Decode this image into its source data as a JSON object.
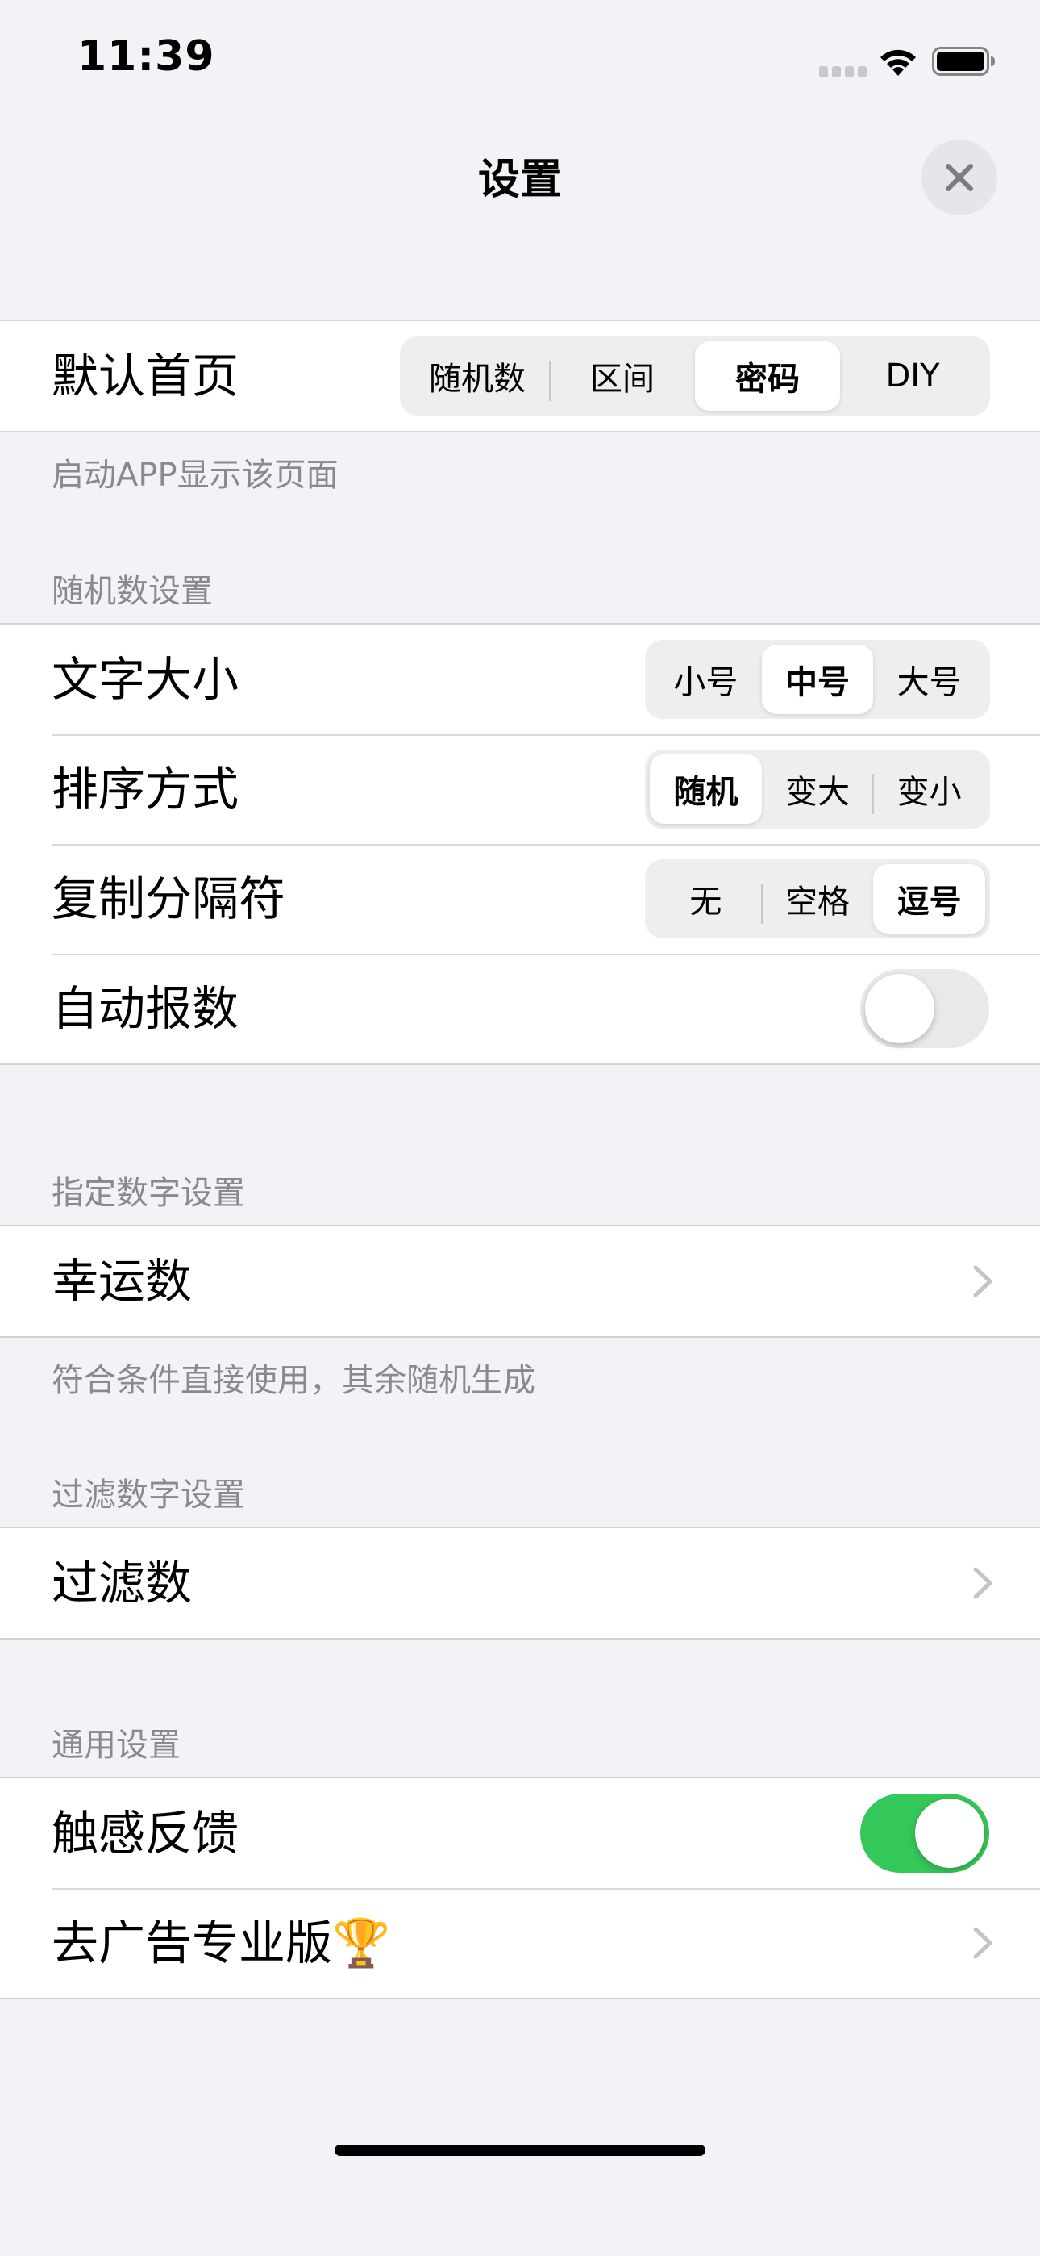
{
  "status": {
    "time": "11:39"
  },
  "nav": {
    "title": "设置"
  },
  "home_page": {
    "label": "默认首页",
    "segments": [
      "随机数",
      "区间",
      "密码",
      "DIY"
    ],
    "selected": "密码",
    "footer": "启动APP显示该页面"
  },
  "random_settings": {
    "header": "随机数设置",
    "font_size": {
      "label": "文字大小",
      "segments": [
        "小号",
        "中号",
        "大号"
      ],
      "selected": "中号"
    },
    "sort_order": {
      "label": "排序方式",
      "segments": [
        "随机",
        "变大",
        "变小"
      ],
      "selected": "随机"
    },
    "copy_separator": {
      "label": "复制分隔符",
      "segments": [
        "无",
        "空格",
        "逗号"
      ],
      "selected": "逗号"
    },
    "auto_announce": {
      "label": "自动报数",
      "on": false
    }
  },
  "designated": {
    "header": "指定数字设置",
    "lucky_label": "幸运数",
    "footer": "符合条件直接使用，其余随机生成"
  },
  "filter": {
    "header": "过滤数字设置",
    "filter_label": "过滤数"
  },
  "general": {
    "header": "通用设置",
    "haptic": {
      "label": "触感反馈",
      "on": true
    },
    "remove_ads_label": "去广告专业版🏆"
  },
  "colors": {
    "toggle_on": "#34C759",
    "toggle_off": "#E9E9EB",
    "background": "#F2F2F7"
  }
}
